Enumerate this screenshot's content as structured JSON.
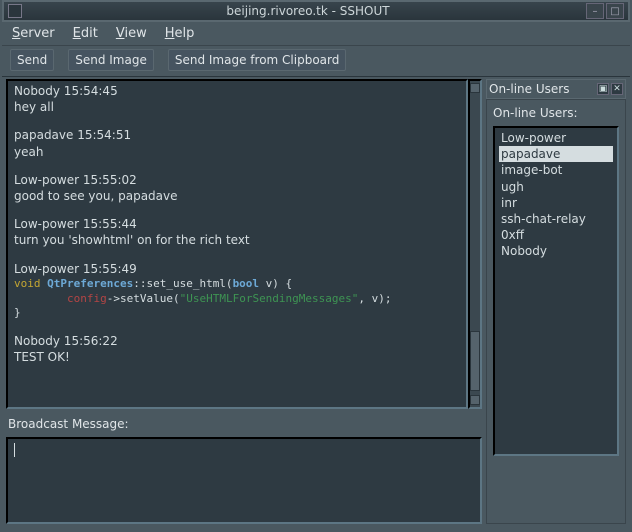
{
  "window": {
    "title": "beijing.rivoreo.tk - SSHOUT"
  },
  "menu": {
    "server": "Server",
    "edit": "Edit",
    "view": "View",
    "help": "Help"
  },
  "toolbar": {
    "send": "Send",
    "send_image": "Send Image",
    "send_image_clipboard": "Send Image from Clipboard"
  },
  "chat": {
    "messages": [
      {
        "meta": "Nobody 15:54:45",
        "body": "hey all"
      },
      {
        "meta": "papadave 15:54:51",
        "body": "yeah"
      },
      {
        "meta": "Low-power 15:55:02",
        "body": "good to see you, papadave"
      },
      {
        "meta": "Low-power 15:55:44",
        "body": "turn you 'showhtml' on for the rich text"
      }
    ],
    "code_meta": "Low-power 15:55:49",
    "code": {
      "kw_void": "void",
      "scope": "QtPreferences",
      "fn": "::set_use_html(",
      "arg_type": "bool",
      "arg_name": " v) {",
      "indent": "        ",
      "cfg": "config",
      "call": "->setValue(",
      "str": "\"UseHTMLForSendingMessages\"",
      "tail": ", v);",
      "close": "}"
    },
    "final": {
      "meta": "Nobody 15:56:22",
      "body": "TEST OK!"
    }
  },
  "broadcast": {
    "label": "Broadcast Message:",
    "value": ""
  },
  "users_panel": {
    "title": "On-line Users",
    "inner_label": "On-line Users:",
    "selected": "papadave",
    "list": [
      "Low-power",
      "papadave",
      "image-bot",
      "ugh",
      "inr",
      "ssh-chat-relay",
      "0xff",
      "Nobody"
    ]
  }
}
